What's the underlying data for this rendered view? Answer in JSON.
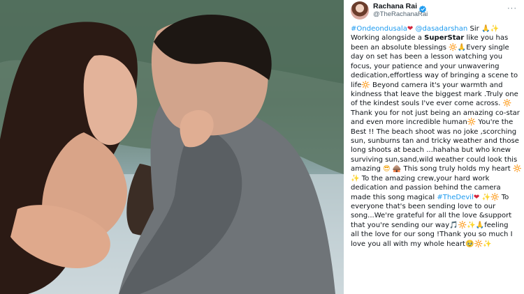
{
  "tweet": {
    "display_name": "Rachana Rai",
    "handle": "@TheRachanaRai",
    "more_label": "···",
    "lines": [
      [
        {
          "t": "#Ondeondusala",
          "c": "link"
        },
        {
          "t": "❤",
          "c": "em-heart"
        },
        {
          "t": " "
        },
        {
          "t": "@dasadarshan",
          "c": "link"
        },
        {
          "t": " Sir "
        },
        {
          "t": "🙏",
          "c": "em-hands"
        },
        {
          "t": "✨",
          "c": "em-spark"
        }
      ],
      [
        {
          "t": "Working alongside a "
        },
        {
          "t": "SuperStar",
          "c": "bold"
        },
        {
          "t": " like you has"
        }
      ],
      [
        {
          "t": "been an absolute blessings "
        },
        {
          "t": "🔆",
          "c": "em-sun"
        },
        {
          "t": "🙏",
          "c": "em-hands"
        },
        {
          "t": "Every single"
        }
      ],
      [
        {
          "t": "day on set has been a lesson watching you"
        }
      ],
      [
        {
          "t": "focus, your patience and your unwavering"
        }
      ],
      [
        {
          "t": "dedication,effortless way of bringing a scene to"
        }
      ],
      [
        {
          "t": "life"
        },
        {
          "t": "🔆",
          "c": "em-sun"
        },
        {
          "t": " Beyond camera it's your warmth and"
        }
      ],
      [
        {
          "t": "kindness that leave the biggest mark .Truly one"
        }
      ],
      [
        {
          "t": "of the kindest souls I've ever come across. "
        },
        {
          "t": "🔆",
          "c": "em-sun"
        }
      ],
      [
        {
          "t": "Thank you for not just being an amazing co-star"
        }
      ],
      [
        {
          "t": "and even more incredible human"
        },
        {
          "t": "🔆",
          "c": "em-sun"
        },
        {
          "t": " You're the"
        }
      ],
      [
        {
          "t": "Best !! The beach shoot was no joke ,scorching"
        }
      ],
      [
        {
          "t": "sun, sunburns tan and tricky weather and those"
        }
      ],
      [
        {
          "t": "long shoots at beach ...hahaha but who knew"
        }
      ],
      [
        {
          "t": "surviving sun,sand,wild weather could look this"
        }
      ],
      [
        {
          "t": "amazing "
        },
        {
          "t": "😎",
          "c": "em-sun"
        },
        {
          "t": " "
        },
        {
          "t": "🛖",
          "c": "em-heart"
        },
        {
          "t": " This song truly holds my heart "
        },
        {
          "t": "🔆",
          "c": "em-sun"
        }
      ],
      [
        {
          "t": "✨",
          "c": "em-spark"
        },
        {
          "t": " To the amazing crew,your hard work"
        }
      ],
      [
        {
          "t": "dedication and passion behind the camera"
        }
      ],
      [
        {
          "t": "made this song magical "
        },
        {
          "t": "#TheDevil",
          "c": "link"
        },
        {
          "t": "❤",
          "c": "em-heart"
        },
        {
          "t": " "
        },
        {
          "t": "✨",
          "c": "em-spark"
        },
        {
          "t": "🔆",
          "c": "em-sun"
        },
        {
          "t": " To"
        }
      ],
      [
        {
          "t": "everyone that's been sending love to our"
        }
      ],
      [
        {
          "t": "song...We're grateful for all the love &support"
        }
      ],
      [
        {
          "t": "that you're sending our way"
        },
        {
          "t": "🎵",
          "c": "em-note"
        },
        {
          "t": "🔆",
          "c": "em-sun"
        },
        {
          "t": " ✨",
          "c": "em-spark"
        },
        {
          "t": "🙏",
          "c": "em-hands"
        },
        {
          "t": "feeling"
        }
      ],
      [
        {
          "t": "all the love for our song !Thank you so much I"
        }
      ],
      [
        {
          "t": "love you all with my whole heart"
        },
        {
          "t": "🥹",
          "c": "em-sun"
        },
        {
          "t": "🔆",
          "c": "em-sun"
        },
        {
          "t": " ✨",
          "c": "em-spark"
        }
      ]
    ]
  },
  "colors": {
    "link": "#1d9bf0",
    "verified": "#1d9bf0",
    "text": "#0f1419",
    "secondary": "#536471"
  },
  "icons": [
    "verified-badge-icon",
    "more-options-icon"
  ]
}
